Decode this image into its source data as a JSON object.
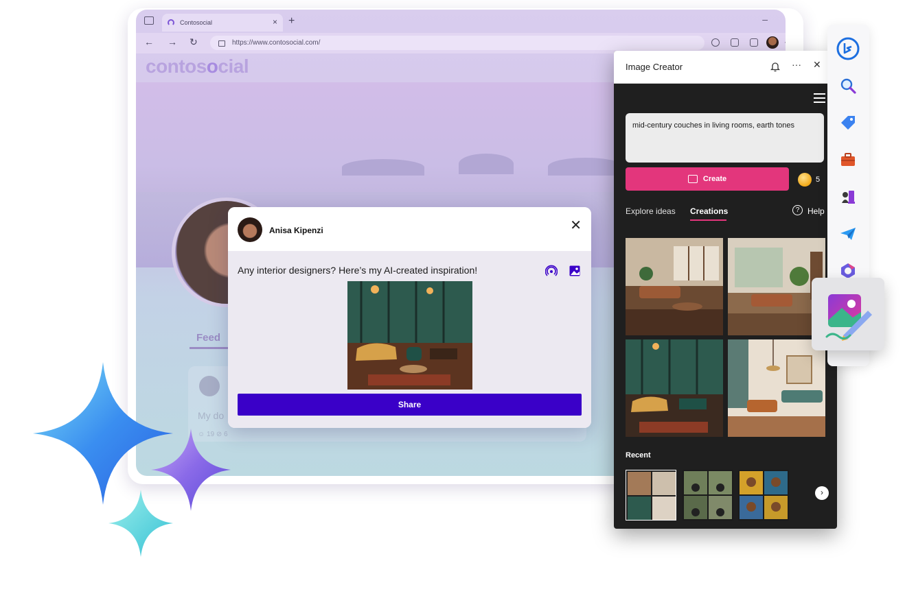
{
  "browser": {
    "tab_title": "Contosocial",
    "tab_close": "×",
    "new_tab": "+",
    "minimize": "–",
    "back": "←",
    "forward": "→",
    "refresh": "↻",
    "url": "https://www.contosocial.com/",
    "more": "···"
  },
  "site": {
    "logo_pre": "contos",
    "logo_o": "o",
    "logo_post": "cial",
    "feed_tab": "Feed",
    "ghost_text": "My do",
    "ghost_meta": "☺ 19   ⊘ 6"
  },
  "dialog": {
    "user_name": "Anisa Kipenzi",
    "close": "✕",
    "post_text": "Any interior designers? Here’s my AI-created inspiration!",
    "share_label": "Share"
  },
  "panel": {
    "title": "Image Creator",
    "more": "···",
    "close": "✕",
    "prompt": "mid-century couches in living rooms, earth tones",
    "create_label": "Create",
    "coins": "5",
    "tab_explore": "Explore ideas",
    "tab_creations": "Creations",
    "help_icon": "?",
    "help_label": "Help",
    "recent_label": "Recent",
    "next": "›",
    "accent": "#e3367c"
  },
  "sidebar": {
    "icons": [
      "bing-icon",
      "search-icon",
      "shopping-tag-icon",
      "tools-icon",
      "games-icon",
      "send-icon",
      "microsoft-365-icon",
      "image-creator-icon"
    ]
  },
  "colors": {
    "share_button": "#3a00c8",
    "create_button": "#e3367c",
    "panel_bg": "#1f1f1f"
  }
}
